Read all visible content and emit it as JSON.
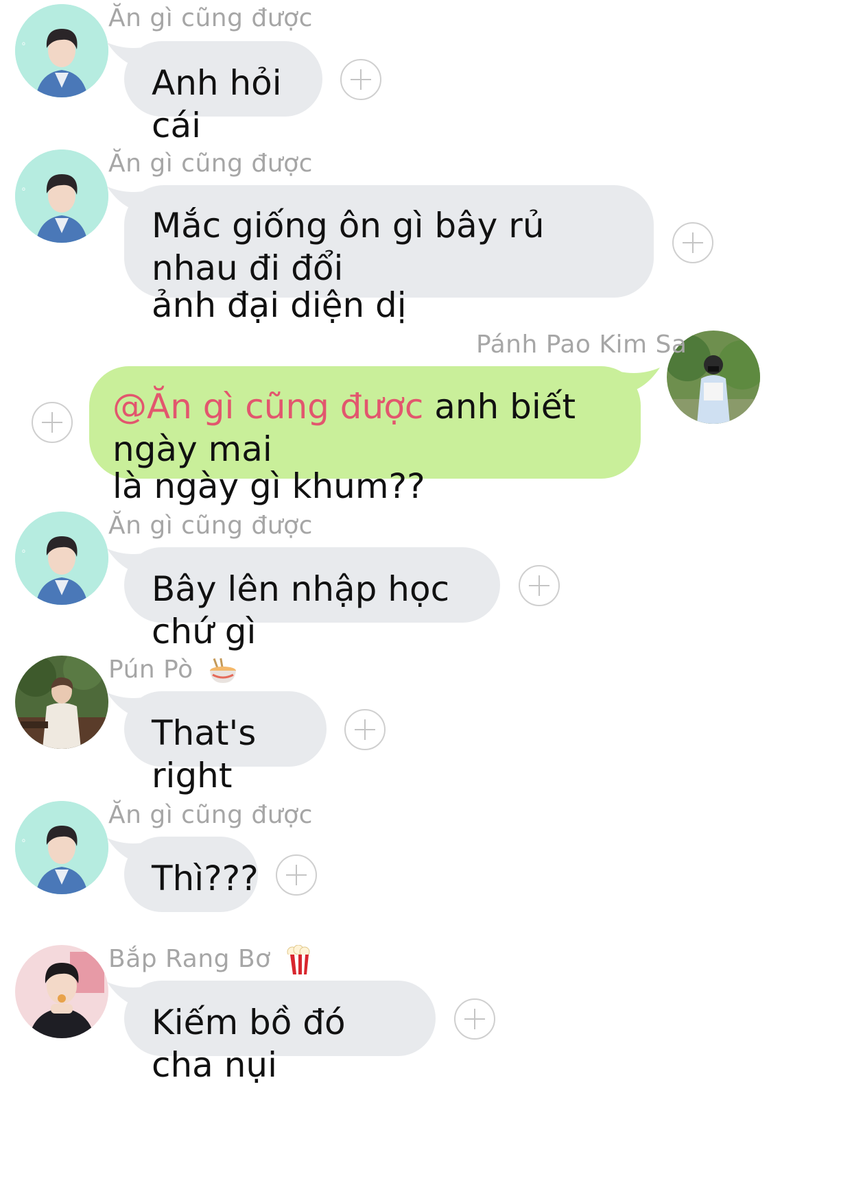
{
  "messages": [
    {
      "sender": "Ăn gì cũng được",
      "text": "Anh hỏi cái",
      "avatar": "teal-avatar"
    },
    {
      "sender": "Ăn gì cũng được",
      "text": "Mắc giống ôn gì bây rủ nhau đi đổi ảnh đại diện dị",
      "line1": "Mắc giống ôn gì bây rủ nhau đi đổi",
      "line2": "ảnh đại diện dị",
      "avatar": "teal-avatar"
    },
    {
      "sender": "Ánh Pao Kim Sa",
      "sender_display": "Pánh Pao Kim Sa",
      "mention": "@Ăn gì cũng được",
      "text_after_mention": " anh biết ngày mai",
      "line2": "là ngày gì khum??",
      "outgoing": true,
      "avatar": "outdoor-avatar"
    },
    {
      "sender": "Ăn gì cũng được",
      "text": "Bây lên nhập học chứ gì",
      "avatar": "teal-avatar"
    },
    {
      "sender": "Pún Pò",
      "sender_emoji": "noodle-bowl-icon",
      "text": "That's right",
      "avatar": "garden-avatar"
    },
    {
      "sender": "Ăn gì cũng được",
      "text": "Thì???",
      "avatar": "teal-avatar"
    },
    {
      "sender": "Bắp Rang Bơ",
      "sender_emoji": "popcorn-icon",
      "text": "Kiếm bồ đó cha nụi",
      "avatar": "pink-avatar"
    }
  ],
  "colors": {
    "incoming_bubble": "#e8eaed",
    "outgoing_bubble": "#c9ef9a",
    "mention": "#e2566e",
    "sender_name": "#a6a6a6"
  }
}
